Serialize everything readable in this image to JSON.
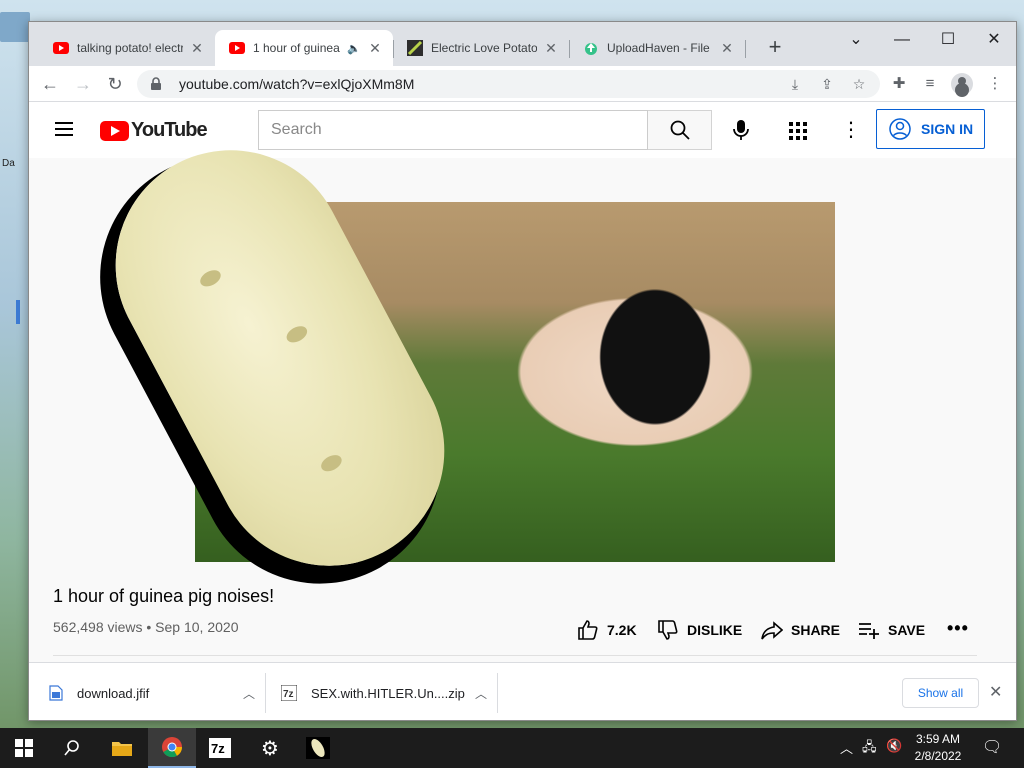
{
  "desktop": {
    "label": "Da"
  },
  "browser": {
    "tabs": [
      {
        "title": "talking potato! electr",
        "favicon": "youtube-icon",
        "active": false
      },
      {
        "title": "1 hour of guinea",
        "favicon": "youtube-icon",
        "active": true,
        "audio": true
      },
      {
        "title": "Electric Love Potato (",
        "favicon": "potato-icon",
        "active": false
      },
      {
        "title": "UploadHaven - File S",
        "favicon": "uploadhaven-icon",
        "active": false
      }
    ],
    "url": "youtube.com/watch?v=exlQjoXMm8M"
  },
  "youtube": {
    "logo_text": "YouTube",
    "search_placeholder": "Search",
    "sign_in": "SIGN IN",
    "video": {
      "title": "1 hour of guinea pig noises!",
      "views_date": "562,498 views • Sep 10, 2020",
      "likes": "7.2K",
      "dislike": "DISLIKE",
      "share": "SHARE",
      "save": "SAVE",
      "more": "•••"
    }
  },
  "downloads": {
    "items": [
      {
        "name": "download.jfif"
      },
      {
        "name": "SEX.with.HITLER.Un....zip"
      }
    ],
    "show_all": "Show all"
  },
  "taskbar": {
    "time": "3:59 AM",
    "date": "2/8/2022"
  },
  "colors": {
    "youtube_red": "#ff0000",
    "link_blue": "#065fd4",
    "chrome_tab_bg": "#dee1e6",
    "taskbar_bg": "#1c1c1c"
  }
}
